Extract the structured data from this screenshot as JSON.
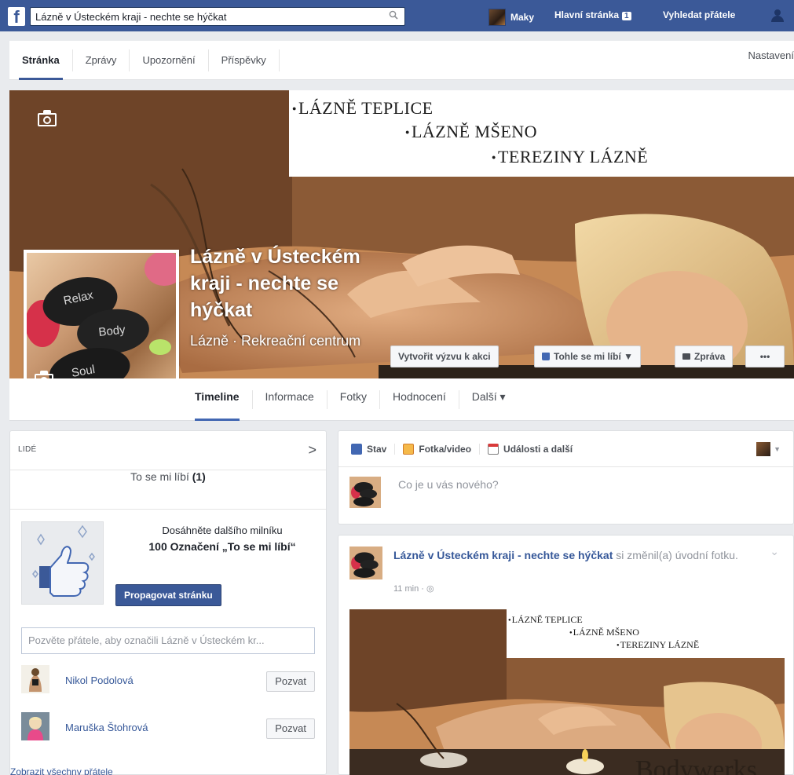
{
  "topbar": {
    "logo": "f",
    "search_value": "Lázně v Ústeckém kraji - nechte se hýčkat",
    "user_name": "Maky",
    "home_label": "Hlavní stránka",
    "home_count": "1",
    "find_friends_label": "Vyhledat přátele",
    "icons": [
      "facebook-logo-icon",
      "search-icon",
      "friend-requests-icon"
    ]
  },
  "admin_nav": {
    "tabs": [
      "Stránka",
      "Zprávy",
      "Upozornění",
      "Příspěvky"
    ],
    "active_tab": "Stránka",
    "settings_label": "Nastavení"
  },
  "cover": {
    "banner_lines": [
      "LÁZNĚ TEPLICE",
      "LÁZNĚ MŠENO",
      "TEREZINY LÁZNĚ"
    ],
    "page_name": "Lázně v Ústeckém kraji - nechte se hýčkat",
    "category": "Lázně · Rekreační centrum",
    "buttons": {
      "cta": "Vytvořit výzvu k akci",
      "like": "Tohle se mi líbí ▼",
      "message": "Zpráva",
      "more": "•••"
    },
    "profile_stones": [
      "Relax",
      "Body",
      "Soul"
    ]
  },
  "sub_nav": {
    "tabs": [
      "Timeline",
      "Informace",
      "Fotky",
      "Hodnocení",
      "Další ▾"
    ],
    "active_tab": "Timeline"
  },
  "people": {
    "title": "LIDÉ",
    "chevron": ">",
    "likes_text": "To se mi líbí",
    "likes_count": "(1)",
    "milestone_line1": "Dosáhněte dalšího milníku",
    "milestone_line2": "100 Označení „To se mi líbí“",
    "promote_button": "Propagovat stránku",
    "invite_placeholder": "Pozvěte přátele, aby označili Lázně v Ústeckém kr...",
    "friends": [
      {
        "name": "Nikol Podolová",
        "button": "Pozvat"
      },
      {
        "name": "Maruška Štohrová",
        "button": "Pozvat"
      }
    ],
    "see_all": "Zobrazit všechny přátele"
  },
  "composer": {
    "tabs": [
      "Stav",
      "Fotka/video",
      "Události a další"
    ],
    "placeholder": "Co je u vás nového?"
  },
  "post": {
    "author": "Lázně v Ústeckém kraji - nechte se hýčkat",
    "action": "si změnil(a) úvodní fotku.",
    "time": "11 min · ◎",
    "image_banner_lines": [
      "LÁZNĚ TEPLICE",
      "LÁZNĚ MŠENO",
      "TEREZINY LÁZNĚ"
    ],
    "image_watermark": "Bodywerks"
  },
  "colors": {
    "brand_blue": "#3b5998",
    "link_blue": "#365899",
    "page_bg": "#e9ebee"
  }
}
